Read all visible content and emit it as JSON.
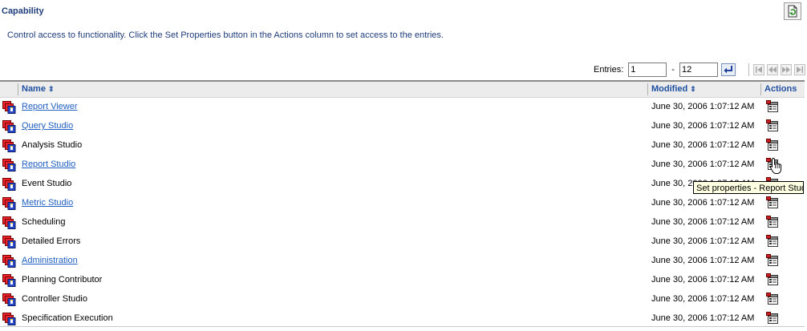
{
  "page": {
    "title": "Capability",
    "description": "Control access to functionality. Click the Set Properties button in the Actions column to set access to the entries."
  },
  "pager": {
    "entries_label": "Entries:",
    "from_value": "1",
    "dash": "-",
    "to_value": "12"
  },
  "table": {
    "columns": {
      "name": "Name",
      "modified": "Modified",
      "actions": "Actions"
    },
    "rows": [
      {
        "name": "Report Viewer",
        "link": true,
        "modified": "June 30, 2006 1:07:12 AM"
      },
      {
        "name": "Query Studio",
        "link": true,
        "modified": "June 30, 2006 1:07:12 AM"
      },
      {
        "name": "Analysis Studio",
        "link": false,
        "modified": "June 30, 2006 1:07:12 AM"
      },
      {
        "name": "Report Studio",
        "link": true,
        "modified": "June 30, 2006 1:07:12 AM"
      },
      {
        "name": "Event Studio",
        "link": false,
        "modified": "June 30, 2006 1:07:12 AM"
      },
      {
        "name": "Metric Studio",
        "link": true,
        "modified": "June 30, 2006 1:07:12 AM"
      },
      {
        "name": "Scheduling",
        "link": false,
        "modified": "June 30, 2006 1:07:12 AM"
      },
      {
        "name": "Detailed Errors",
        "link": false,
        "modified": "June 30, 2006 1:07:12 AM"
      },
      {
        "name": "Administration",
        "link": true,
        "modified": "June 30, 2006 1:07:12 AM"
      },
      {
        "name": "Planning Contributor",
        "link": false,
        "modified": "June 30, 2006 1:07:12 AM"
      },
      {
        "name": "Controller Studio",
        "link": false,
        "modified": "June 30, 2006 1:07:12 AM"
      },
      {
        "name": "Specification Execution",
        "link": false,
        "modified": "June 30, 2006 1:07:12 AM"
      }
    ]
  },
  "tooltip": {
    "text": "Set properties - Report Studio"
  },
  "icons": {
    "row_icon": "capability-icon",
    "action_icon": "set-properties-icon",
    "refresh": "refresh-icon"
  },
  "colors": {
    "link": "#1f5fbf",
    "header_text": "#1f4fa0",
    "title": "#1f3d7a"
  }
}
